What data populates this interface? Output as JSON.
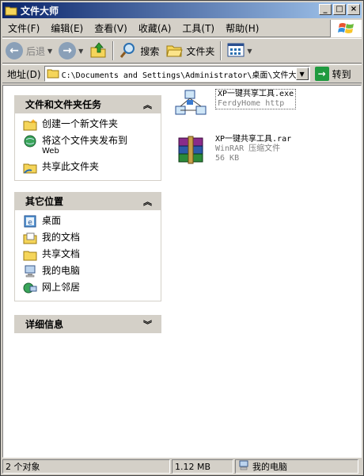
{
  "window": {
    "title": "文件大师"
  },
  "menu": {
    "items": [
      {
        "label": "文件(F)"
      },
      {
        "label": "编辑(E)"
      },
      {
        "label": "查看(V)"
      },
      {
        "label": "收藏(A)"
      },
      {
        "label": "工具(T)"
      },
      {
        "label": "帮助(H)"
      }
    ]
  },
  "toolbar": {
    "back_label": "后退",
    "search_label": "搜索",
    "folders_label": "文件夹"
  },
  "address": {
    "label": "地址(D)",
    "value": "C:\\Documents and Settings\\Administrator\\桌面\\文件大师",
    "go_label": "转到"
  },
  "tasks_panel": {
    "title": "文件和文件夹任务",
    "items": [
      {
        "label": "创建一个新文件夹",
        "sub": ""
      },
      {
        "label": "将这个文件夹发布到",
        "sub": "Web"
      },
      {
        "label": "共享此文件夹",
        "sub": ""
      }
    ]
  },
  "places_panel": {
    "title": "其它位置",
    "items": [
      {
        "label": "桌面"
      },
      {
        "label": "我的文档"
      },
      {
        "label": "共享文档"
      },
      {
        "label": "我的电脑"
      },
      {
        "label": "网上邻居"
      }
    ]
  },
  "details_panel": {
    "title": "详细信息"
  },
  "files": [
    {
      "name": "XP一键共享工具.exe",
      "meta1": "FerdyHome  http",
      "meta2": ""
    },
    {
      "name": "XP一键共享工具.rar",
      "meta1": "WinRAR 压缩文件",
      "meta2": "56 KB"
    }
  ],
  "status": {
    "objects": "2 个对象",
    "size": "1.12 MB",
    "location": "我的电脑"
  },
  "colors": {
    "title_start": "#0a246a",
    "title_end": "#a6caf0",
    "chrome": "#d4d0c8"
  }
}
